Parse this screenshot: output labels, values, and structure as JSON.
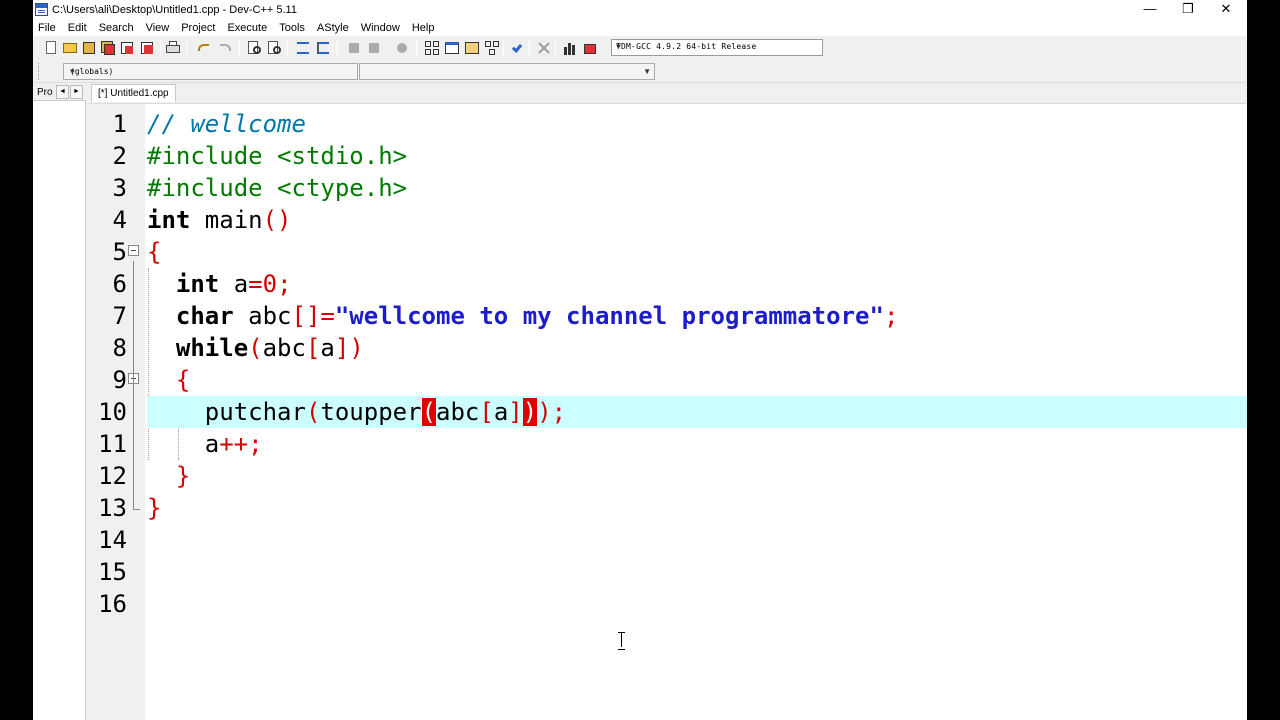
{
  "window": {
    "title": "C:\\Users\\ali\\Desktop\\Untitled1.cpp - Dev-C++ 5.11",
    "minimize": "—",
    "restore": "❐",
    "close": "✕"
  },
  "menu": [
    "File",
    "Edit",
    "Search",
    "View",
    "Project",
    "Execute",
    "Tools",
    "AStyle",
    "Window",
    "Help"
  ],
  "toolbar": {
    "compiler": "TDM-GCC 4.9.2 64-bit Release",
    "scope": "(globals)",
    "member": ""
  },
  "left_panel": {
    "tab_label": "Pro",
    "prev": "◄",
    "next": "►"
  },
  "editor": {
    "tab_label": "[*] Untitled1.cpp",
    "line_numbers": [
      "1",
      "2",
      "3",
      "4",
      "5",
      "6",
      "7",
      "8",
      "9",
      "10",
      "11",
      "12",
      "13",
      "14",
      "15",
      "16"
    ],
    "highlighted_line": 10,
    "colors": {
      "highlight": "#ccffff",
      "comment": "#0077aa",
      "preprocessor": "#007a00",
      "symbol": "#d40000",
      "string": "#1c1cc8",
      "brace_match": "#e00000"
    },
    "lines": {
      "l1": "// wellcome",
      "l2": "#include <stdio.h>",
      "l3": "#include <ctype.h>",
      "l4_kw": "int",
      "l4_rest": " main",
      "l4_paren": "()",
      "l5": "{",
      "l6_kw": "int",
      "l6_a": " a",
      "l6_eq": "=",
      "l6_num": "0",
      "l6_semi": ";",
      "l7_kw": "char",
      "l7_name": " abc",
      "l7_op": "[]=",
      "l7_str": "\"wellcome to my channel programmatore\"",
      "l7_semi": ";",
      "l8_kw": "while",
      "l8_p1": "(",
      "l8_abc": "abc",
      "l8_b1": "[",
      "l8_a": "a",
      "l8_b2": "])",
      "l9": "{",
      "l10_fn": "putchar",
      "l10_p1": "(",
      "l10_fn2": "toupper",
      "l10_bm1": "(",
      "l10_abc": "abc",
      "l10_b1": "[",
      "l10_a": "a",
      "l10_b2": "]",
      "l10_bm2": ")",
      "l10_end": ");",
      "l11_a": "a",
      "l11_op": "++;",
      "l12": "}",
      "l13": "}"
    }
  }
}
